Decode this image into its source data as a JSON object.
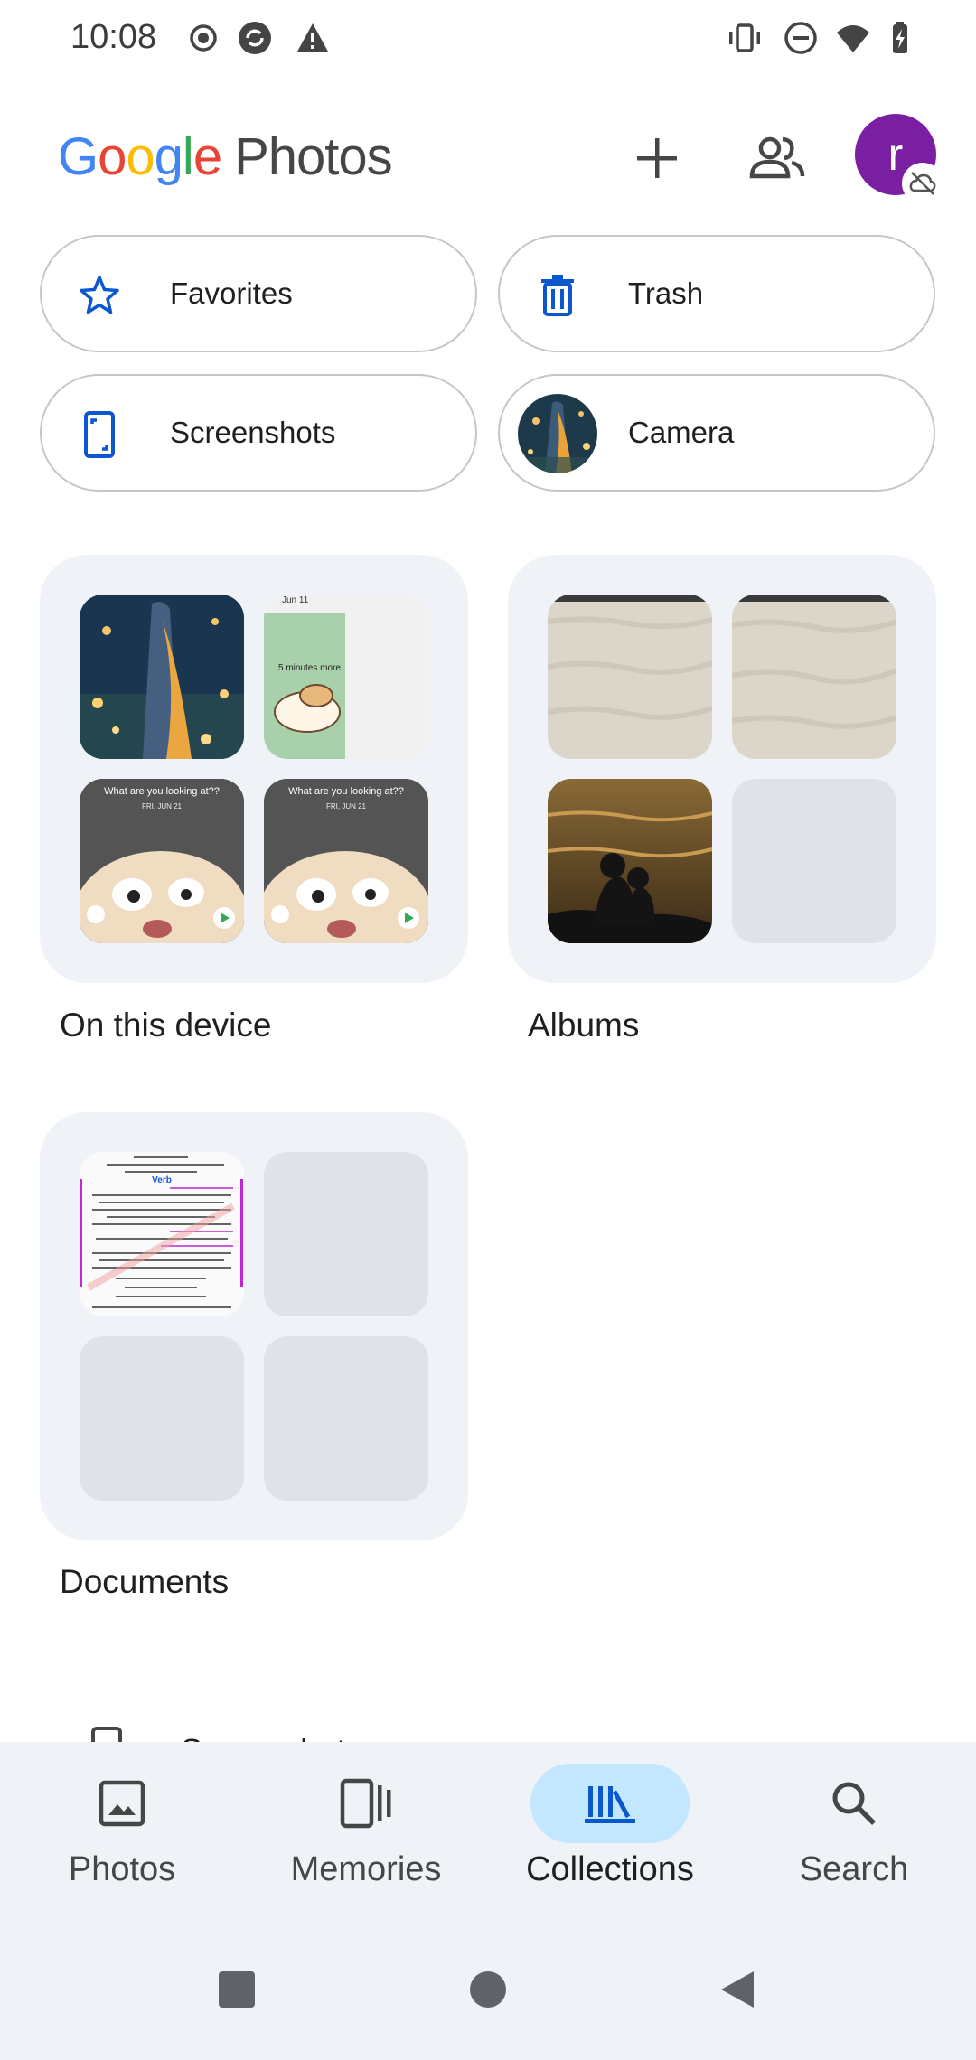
{
  "status_bar": {
    "time": "10:08",
    "icons": [
      "record-icon",
      "sync-icon",
      "warning-icon",
      "vibrate-icon",
      "do-not-disturb-icon",
      "wifi-icon",
      "battery-charging-icon"
    ]
  },
  "header": {
    "logo_letters": [
      "G",
      "o",
      "o",
      "g",
      "l",
      "e"
    ],
    "product_name": "Photos",
    "avatar_initial": "r",
    "actions": [
      "add-icon",
      "shared-people-icon"
    ],
    "colors": {
      "avatar": "#7b1fa2",
      "brand_blue": "#4285F4",
      "brand_red": "#EA4335",
      "brand_yellow": "#FBBC05",
      "brand_green": "#34A853"
    }
  },
  "chips": [
    {
      "label": "Favorites",
      "icon": "star-icon"
    },
    {
      "label": "Trash",
      "icon": "trash-icon"
    },
    {
      "label": "Screenshots",
      "icon": "screenshot-phone-icon"
    },
    {
      "label": "Camera",
      "icon": "camera-thumbnail"
    }
  ],
  "collections": [
    {
      "label": "On this device",
      "tiles": [
        {
          "kind": "night-forest-photo"
        },
        {
          "kind": "cartoon-screenshot",
          "text_top": "Jun 11",
          "text_mid": "5 minutes more.."
        },
        {
          "kind": "lockscreen-screenshot",
          "text": "What are you looking at??",
          "subtext": "FRI, JUN 21"
        },
        {
          "kind": "lockscreen-screenshot",
          "text": "What are you looking at??",
          "subtext": "FRI, JUN 21"
        }
      ]
    },
    {
      "label": "Albums",
      "tiles": [
        {
          "kind": "sand-photo"
        },
        {
          "kind": "sand-photo"
        },
        {
          "kind": "sunset-couple-photo"
        },
        {
          "kind": "empty"
        }
      ]
    },
    {
      "label": "Documents",
      "tiles": [
        {
          "kind": "document-page",
          "heading": "Verb"
        },
        {
          "kind": "empty"
        },
        {
          "kind": "empty"
        },
        {
          "kind": "empty"
        }
      ]
    }
  ],
  "peek_label": "Screenshots",
  "bottom_nav": {
    "items": [
      {
        "label": "Photos",
        "icon": "photo-icon",
        "active": false
      },
      {
        "label": "Memories",
        "icon": "memories-icon",
        "active": false
      },
      {
        "label": "Collections",
        "icon": "collections-icon",
        "active": true
      },
      {
        "label": "Search",
        "icon": "search-icon",
        "active": false
      }
    ],
    "colors": {
      "active_pill": "#c2e7ff",
      "background": "#eff3f8"
    }
  },
  "system_nav": [
    "recents-square-icon",
    "home-circle-icon",
    "back-triangle-icon"
  ]
}
